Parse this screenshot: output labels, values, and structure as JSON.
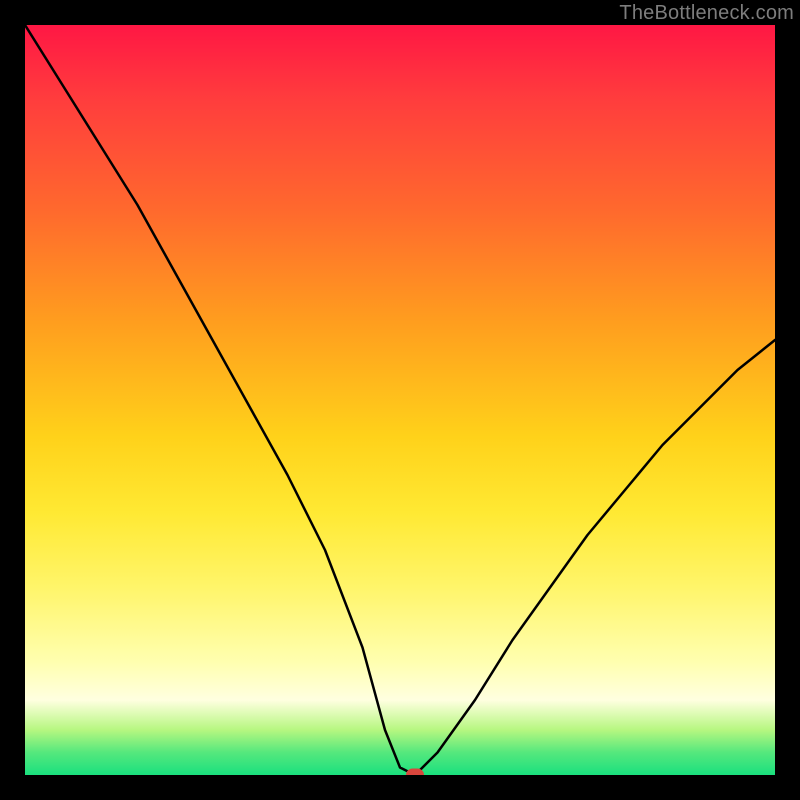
{
  "watermark": "TheBottleneck.com",
  "chart_data": {
    "type": "line",
    "title": "",
    "xlabel": "",
    "ylabel": "",
    "xlim": [
      0,
      100
    ],
    "ylim": [
      0,
      100
    ],
    "grid": false,
    "series": [
      {
        "name": "bottleneck-curve",
        "x": [
          0,
          5,
          10,
          15,
          20,
          25,
          30,
          35,
          40,
          45,
          48,
          50,
          52,
          55,
          60,
          65,
          70,
          75,
          80,
          85,
          90,
          95,
          100
        ],
        "values": [
          100,
          92,
          84,
          76,
          67,
          58,
          49,
          40,
          30,
          17,
          6,
          1,
          0,
          3,
          10,
          18,
          25,
          32,
          38,
          44,
          49,
          54,
          58
        ]
      }
    ],
    "marker": {
      "x": 52,
      "y": 0,
      "color": "#d9463d"
    },
    "background_gradient": {
      "top": "#ff1744",
      "mid": "#ffd21a",
      "bottom": "#1ae07e"
    }
  }
}
